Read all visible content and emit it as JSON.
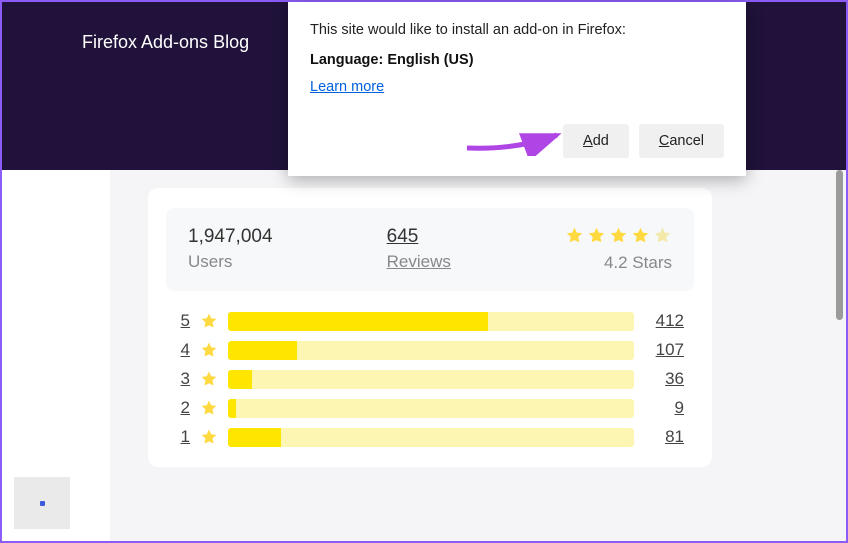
{
  "header": {
    "blog_title": "Firefox Add-ons Blog"
  },
  "dialog": {
    "message": "This site would like to install an add-on in Firefox:",
    "language_line": "Language: English (US)",
    "learn_more": "Learn more",
    "add_label": "Add",
    "cancel_label": "Cancel"
  },
  "summary": {
    "users_count": "1,947,004",
    "users_label": "Users",
    "reviews_count": "645",
    "reviews_label": "Reviews",
    "stars_label": "4.2 Stars",
    "stars_value": 4.2
  },
  "ratings": [
    {
      "level": "5",
      "count": "412",
      "pct": 64
    },
    {
      "level": "4",
      "count": "107",
      "pct": 17
    },
    {
      "level": "3",
      "count": "36",
      "pct": 6
    },
    {
      "level": "2",
      "count": "9",
      "pct": 2
    },
    {
      "level": "1",
      "count": "81",
      "pct": 13
    }
  ],
  "colors": {
    "header_bg": "#20123a",
    "star_full": "#ffd940",
    "star_empty": "#f3e9a8",
    "bar_fill": "#ffe600",
    "bar_track": "#fdf6b2",
    "link": "#0060df",
    "arrow": "#b045e6"
  }
}
